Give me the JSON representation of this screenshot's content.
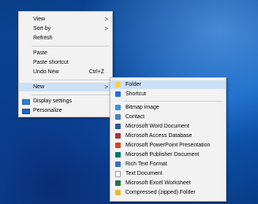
{
  "context_menu": {
    "items": [
      {
        "label": "View"
      },
      {
        "label": "Sort by"
      },
      {
        "label": "Refresh"
      },
      {
        "label": "Paste"
      },
      {
        "label": "Paste shortcut"
      },
      {
        "label": "Undo New",
        "shortcut": "Ctrl+Z"
      },
      {
        "label": "New"
      },
      {
        "label": "Display settings"
      },
      {
        "label": "Personalize"
      }
    ],
    "submenu_arrow": ">"
  },
  "new_submenu": {
    "items": [
      {
        "label": "Folder",
        "icon": "folder-icon",
        "color": "#f6cf5b"
      },
      {
        "label": "Shortcut",
        "icon": "shortcut-icon",
        "color": "#2a6fd6"
      },
      {
        "label": "Bitmap image",
        "icon": "bitmap-icon",
        "color": "#3f8fd8"
      },
      {
        "label": "Contact",
        "icon": "contact-icon",
        "color": "#4a7fbf"
      },
      {
        "label": "Microsoft Word Document",
        "icon": "word-icon",
        "color": "#2b579a"
      },
      {
        "label": "Microsoft Access Database",
        "icon": "access-icon",
        "color": "#a4373a"
      },
      {
        "label": "Microsoft PowerPoint Presentation",
        "icon": "powerpoint-icon",
        "color": "#d24726"
      },
      {
        "label": "Microsoft Publisher Document",
        "icon": "publisher-icon",
        "color": "#077568"
      },
      {
        "label": "Rich Text Format",
        "icon": "rtf-icon",
        "color": "#3b6fb6"
      },
      {
        "label": "Text Document",
        "icon": "text-document-icon",
        "color": "#d9d9d9"
      },
      {
        "label": "Microsoft Excel Worksheet",
        "icon": "excel-icon",
        "color": "#217346"
      },
      {
        "label": "Compressed (zipped) Folder",
        "icon": "zip-folder-icon",
        "color": "#e8b836"
      }
    ]
  }
}
